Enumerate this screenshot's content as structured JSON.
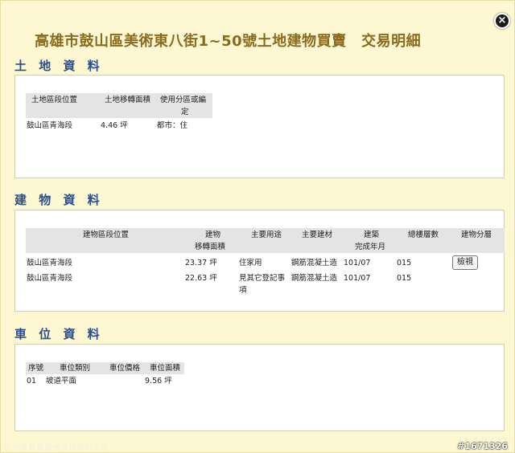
{
  "title": "高雄市鼓山區美術東八街1~50號土地建物買賣　交易明細",
  "close_label": "×",
  "land": {
    "heading": "土 地 資 料",
    "headers": [
      "土地區段位置",
      "土地移轉面積",
      "使用分區或編",
      "定"
    ],
    "row": {
      "location": "鼓山區青海段",
      "area": "4.46  坪",
      "zoning": "都市：住"
    }
  },
  "building": {
    "heading": "建 物 資 料",
    "headers": {
      "location": "建物區段位置",
      "area_1": "建物",
      "area_2": "移轉面積",
      "use": "主要用途",
      "material": "主要建材",
      "built_1": "建築",
      "built_2": "完成年月",
      "floors": "總樓層數",
      "layout": "建物分層"
    },
    "rows": [
      {
        "location": "鼓山區青海段",
        "area": "23.37  坪",
        "use": "住家用",
        "material": "鋼筋混凝土造",
        "built": "101/07",
        "floors": "015",
        "button": "檢視"
      },
      {
        "location": "鼓山區青海段",
        "area": "22.63  坪",
        "use_1": "見其它登記事",
        "use_2": "項",
        "material": "鋼筋混凝土造",
        "built": "101/07",
        "floors": "015"
      }
    ]
  },
  "parking": {
    "heading": "車 位 資 料",
    "headers": [
      "序號",
      "車位類別",
      "車位價格",
      "車位面積"
    ],
    "row": {
      "no": "01",
      "type": "坡道平面",
      "price": "",
      "area": "9.56  坪"
    }
  },
  "footer": {
    "left": "房地產買賣實價登錄資料查詢",
    "right": "#1671326"
  }
}
